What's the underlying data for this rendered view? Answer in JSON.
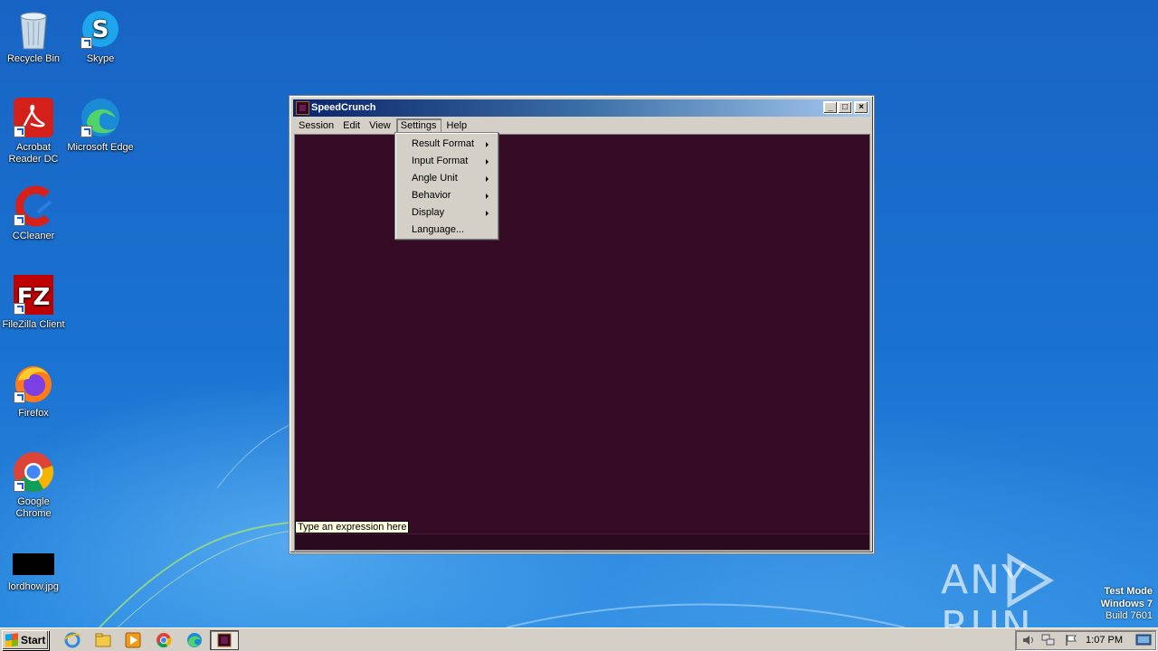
{
  "desktop": {
    "icons": [
      {
        "label": "Recycle Bin",
        "icon": "recycle-bin-icon"
      },
      {
        "label": "Skype",
        "icon": "skype-icon"
      },
      {
        "label": "Acrobat Reader DC",
        "icon": "acrobat-icon"
      },
      {
        "label": "Microsoft Edge",
        "icon": "edge-icon"
      },
      {
        "label": "CCleaner",
        "icon": "ccleaner-icon"
      },
      {
        "label": "FileZilla Client",
        "icon": "filezilla-icon"
      },
      {
        "label": "Firefox",
        "icon": "firefox-icon"
      },
      {
        "label": "Google Chrome",
        "icon": "chrome-icon"
      },
      {
        "label": "lordhow.jpg",
        "icon": "image-file-icon"
      }
    ]
  },
  "window": {
    "title": "SpeedCrunch",
    "menu": [
      "Session",
      "Edit",
      "View",
      "Settings",
      "Help"
    ],
    "active_menu": "Settings",
    "hint": "Type an expression here",
    "background_color": "#350b26"
  },
  "settings_menu": {
    "items": [
      {
        "label": "Result Format",
        "submenu": true
      },
      {
        "label": "Input Format",
        "submenu": true
      },
      {
        "label": "Angle Unit",
        "submenu": true
      },
      {
        "label": "Behavior",
        "submenu": true
      },
      {
        "label": "Display",
        "submenu": true
      },
      {
        "label": "Language...",
        "submenu": false
      }
    ]
  },
  "watermark": {
    "text": "ANY RUN"
  },
  "os_info": {
    "line1": "Test Mode",
    "line2": "Windows 7",
    "line3": "Build 7601"
  },
  "taskbar": {
    "start_label": "Start",
    "quick_launch": [
      "ie-icon",
      "explorer-icon",
      "media-player-icon",
      "chrome-icon",
      "edge-icon"
    ],
    "clock": "1:07 PM"
  }
}
